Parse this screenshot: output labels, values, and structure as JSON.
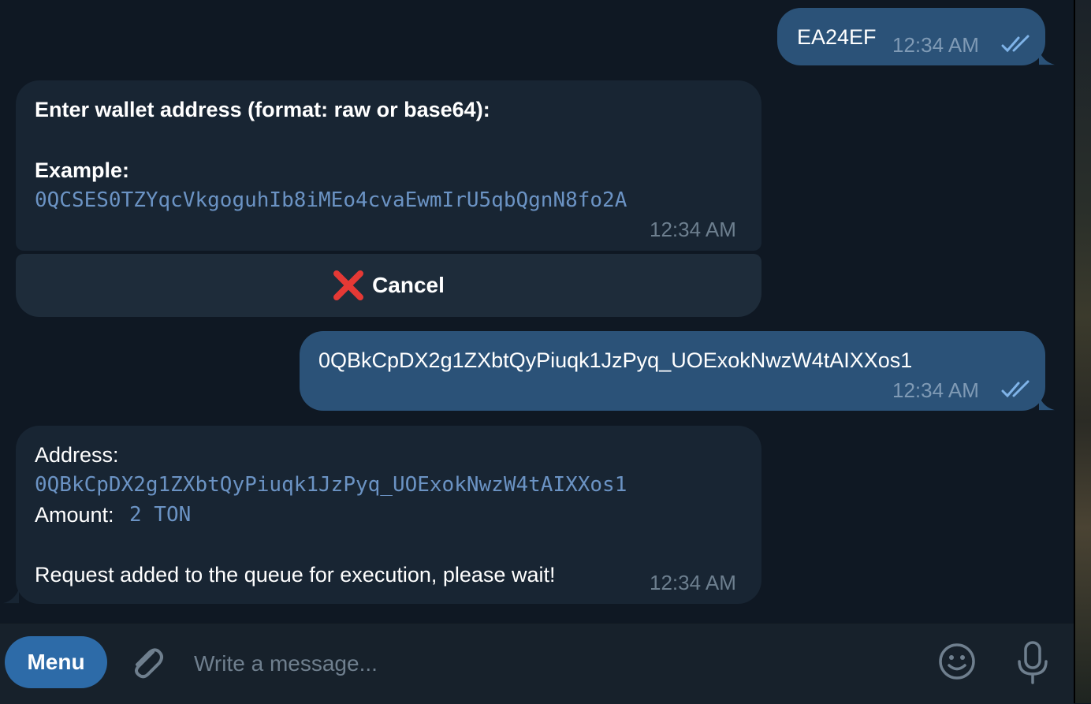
{
  "messages": [
    {
      "id": "m1",
      "direction": "outgoing",
      "text": "EA24EF",
      "time": "12:34 AM",
      "status_icon": "double-check-icon"
    },
    {
      "id": "m2",
      "direction": "incoming",
      "prompt": "Enter wallet address (format: raw or base64):",
      "example_label": "Example:",
      "example_value": "0QCSES0TZYqcVkgoguhIb8iMEo4cvaEwmIrU5qbQgnN8fo2A",
      "time": "12:34 AM"
    },
    {
      "id": "m3",
      "direction": "outgoing",
      "text": "0QBkCpDX2g1ZXbtQyPiuqk1JzPyq_UOExokNwzW4tAIXXos1",
      "time": "12:34 AM",
      "status_icon": "double-check-icon"
    },
    {
      "id": "m4",
      "direction": "incoming",
      "address_label": "Address:",
      "address_value": "0QBkCpDX2g1ZXbtQyPiuqk1JzPyq_UOExokNwzW4tAIXXos1",
      "amount_label": "Amount:",
      "amount_value": "2 TON",
      "status_text": "Request added to the queue for execution, please wait!",
      "time": "12:34 AM"
    }
  ],
  "inline_keyboard": {
    "cancel_label": "Cancel",
    "cancel_icon": "red-cross-icon"
  },
  "composer": {
    "menu_label": "Menu",
    "placeholder": "Write a message...",
    "attach_icon": "paperclip-icon",
    "emoji_icon": "smiley-icon",
    "mic_icon": "microphone-icon"
  },
  "colors": {
    "background": "#0f1823",
    "outgoing_bubble": "#2b5278",
    "incoming_bubble": "#182533",
    "link_mono": "#6b93c4",
    "accent": "#2d6ba8",
    "cancel_icon": "#e53935"
  }
}
